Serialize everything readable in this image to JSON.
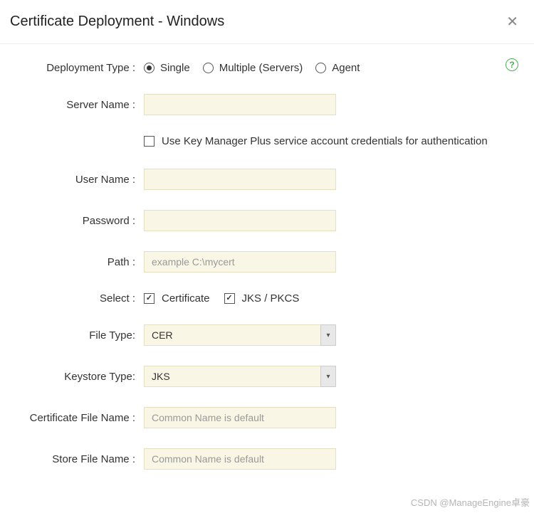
{
  "header": {
    "title": "Certificate Deployment - Windows"
  },
  "form": {
    "deployment_type": {
      "label": "Deployment Type :",
      "options": [
        "Single",
        "Multiple (Servers)",
        "Agent"
      ],
      "selected": "Single"
    },
    "server_name": {
      "label": "Server Name :",
      "value": ""
    },
    "use_service_account": {
      "label": "Use Key Manager Plus service account credentials for authentication",
      "checked": false
    },
    "user_name": {
      "label": "User Name :",
      "value": ""
    },
    "password": {
      "label": "Password :",
      "value": ""
    },
    "path": {
      "label": "Path :",
      "placeholder": "example C:\\mycert",
      "value": ""
    },
    "select": {
      "label": "Select :",
      "certificate": {
        "label": "Certificate",
        "checked": true
      },
      "jks_pkcs": {
        "label": "JKS / PKCS",
        "checked": true
      }
    },
    "file_type": {
      "label": "File Type:",
      "value": "CER"
    },
    "keystore_type": {
      "label": "Keystore Type:",
      "value": "JKS"
    },
    "cert_file_name": {
      "label": "Certificate File Name :",
      "placeholder": "Common Name is default",
      "value": ""
    },
    "store_file_name": {
      "label": "Store File Name :",
      "placeholder": "Common Name is default",
      "value": ""
    }
  },
  "watermark": "CSDN @ManageEngine卓豪"
}
